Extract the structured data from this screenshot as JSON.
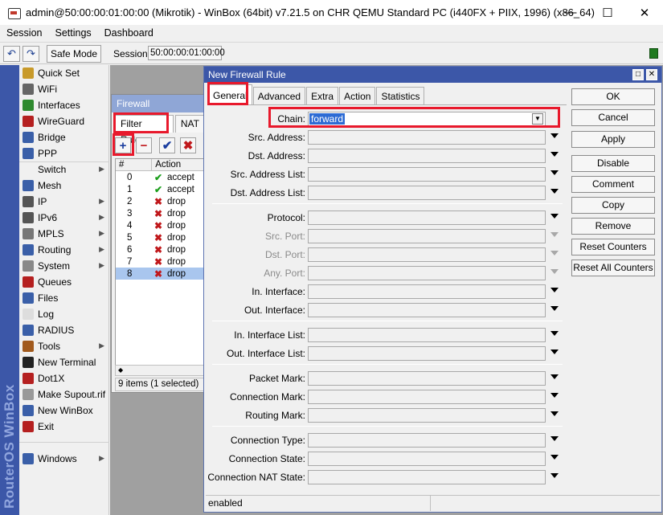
{
  "window": {
    "title": "admin@50:00:00:01:00:00 (Mikrotik) - WinBox (64bit) v7.21.5 on CHR QEMU Standard PC (i440FX + PIIX, 1996) (x86_64)",
    "minimize": "—",
    "maximize": "☐",
    "close": "✕"
  },
  "menu": {
    "session": "Session",
    "settings": "Settings",
    "dashboard": "Dashboard"
  },
  "toolbar": {
    "undo_icon": "↶",
    "redo_icon": "↷",
    "safe_mode": "Safe Mode",
    "session_label": "Session:",
    "session_value": "50:00:00:01:00:00",
    "status_color": "#1f7a1f"
  },
  "brand": "RouterOS WinBox",
  "sidebar": {
    "items": [
      {
        "label": "Quick Set",
        "icon": "wand-icon",
        "color": "#c89a2a",
        "arrow": ""
      },
      {
        "label": "WiFi",
        "icon": "wifi-icon",
        "color": "#666666",
        "arrow": ""
      },
      {
        "label": "Interfaces",
        "icon": "interfaces-icon",
        "color": "#2f8a2f",
        "arrow": ""
      },
      {
        "label": "WireGuard",
        "icon": "wireguard-icon",
        "color": "#b52020",
        "arrow": ""
      },
      {
        "label": "Bridge",
        "icon": "bridge-icon",
        "color": "#3a5fa8",
        "arrow": ""
      },
      {
        "label": "PPP",
        "icon": "ppp-icon",
        "color": "#3a5fa8",
        "arrow": ""
      },
      {
        "label": "Switch",
        "icon": "switch-icon",
        "color": "#dcdcdc",
        "arrow": "▶"
      },
      {
        "label": "Mesh",
        "icon": "mesh-icon",
        "color": "#3a5fa8",
        "arrow": ""
      },
      {
        "label": "IP",
        "icon": "ip-icon",
        "color": "#555555",
        "arrow": "▶"
      },
      {
        "label": "IPv6",
        "icon": "ipv6-icon",
        "color": "#555555",
        "arrow": "▶"
      },
      {
        "label": "MPLS",
        "icon": "mpls-icon",
        "color": "#777777",
        "arrow": "▶"
      },
      {
        "label": "Routing",
        "icon": "routing-icon",
        "color": "#3a5fa8",
        "arrow": "▶"
      },
      {
        "label": "System",
        "icon": "system-icon",
        "color": "#888888",
        "arrow": "▶"
      },
      {
        "label": "Queues",
        "icon": "queues-icon",
        "color": "#b52020",
        "arrow": ""
      },
      {
        "label": "Files",
        "icon": "files-icon",
        "color": "#3a5fa8",
        "arrow": ""
      },
      {
        "label": "Log",
        "icon": "log-icon",
        "color": "#dddddd",
        "arrow": ""
      },
      {
        "label": "RADIUS",
        "icon": "radius-icon",
        "color": "#3a5fa8",
        "arrow": ""
      },
      {
        "label": "Tools",
        "icon": "tools-icon",
        "color": "#a15a1d",
        "arrow": "▶"
      },
      {
        "label": "New Terminal",
        "icon": "terminal-icon",
        "color": "#222222",
        "arrow": ""
      },
      {
        "label": "Dot1X",
        "icon": "dot1x-icon",
        "color": "#b52020",
        "arrow": ""
      },
      {
        "label": "Make Supout.rif",
        "icon": "supout-icon",
        "color": "#999999",
        "arrow": ""
      },
      {
        "label": "New WinBox",
        "icon": "winbox-icon",
        "color": "#3a5fa8",
        "arrow": ""
      },
      {
        "label": "Exit",
        "icon": "exit-icon",
        "color": "#b52020",
        "arrow": ""
      },
      {
        "label": "Windows",
        "icon": "windows-icon",
        "color": "#3a5fa8",
        "arrow": "▶"
      }
    ]
  },
  "firewall": {
    "title": "Firewall",
    "tabs": [
      "Filter Rules",
      "NAT"
    ],
    "buttons": {
      "add": "+",
      "remove": "−",
      "enable": "✔",
      "disable": "✖"
    },
    "columns": [
      "#",
      "Action"
    ],
    "rows": [
      {
        "num": "0",
        "action": "accept",
        "icon": "✔"
      },
      {
        "num": "1",
        "action": "accept",
        "icon": "✔"
      },
      {
        "num": "2",
        "action": "drop",
        "icon": "✖"
      },
      {
        "num": "3",
        "action": "drop",
        "icon": "✖"
      },
      {
        "num": "4",
        "action": "drop",
        "icon": "✖"
      },
      {
        "num": "5",
        "action": "drop",
        "icon": "✖"
      },
      {
        "num": "6",
        "action": "drop",
        "icon": "✖"
      },
      {
        "num": "7",
        "action": "drop",
        "icon": "✖"
      },
      {
        "num": "8",
        "action": "drop",
        "icon": "✖"
      }
    ],
    "scroll_left": "◆",
    "status": "9 items (1 selected)"
  },
  "dialog": {
    "title": "New Firewall Rule",
    "tabs": [
      "General",
      "Advanced",
      "Extra",
      "Action",
      "Statistics"
    ],
    "fields": {
      "chain_label": "Chain:",
      "chain_value": "forward",
      "chain_dropdown": "▼",
      "labels": [
        "Src. Address:",
        "Dst. Address:",
        "Src. Address List:",
        "Dst. Address List:",
        "Protocol:",
        "Src. Port:",
        "Dst. Port:",
        "Any. Port:",
        "In. Interface:",
        "Out. Interface:",
        "In. Interface List:",
        "Out. Interface List:",
        "Packet Mark:",
        "Connection Mark:",
        "Routing Mark:",
        "Connection Type:",
        "Connection State:",
        "Connection NAT State:"
      ]
    },
    "buttons": [
      "OK",
      "Cancel",
      "Apply",
      "Disable",
      "Comment",
      "Copy",
      "Remove",
      "Reset Counters",
      "Reset All Counters"
    ],
    "status": "enabled"
  }
}
